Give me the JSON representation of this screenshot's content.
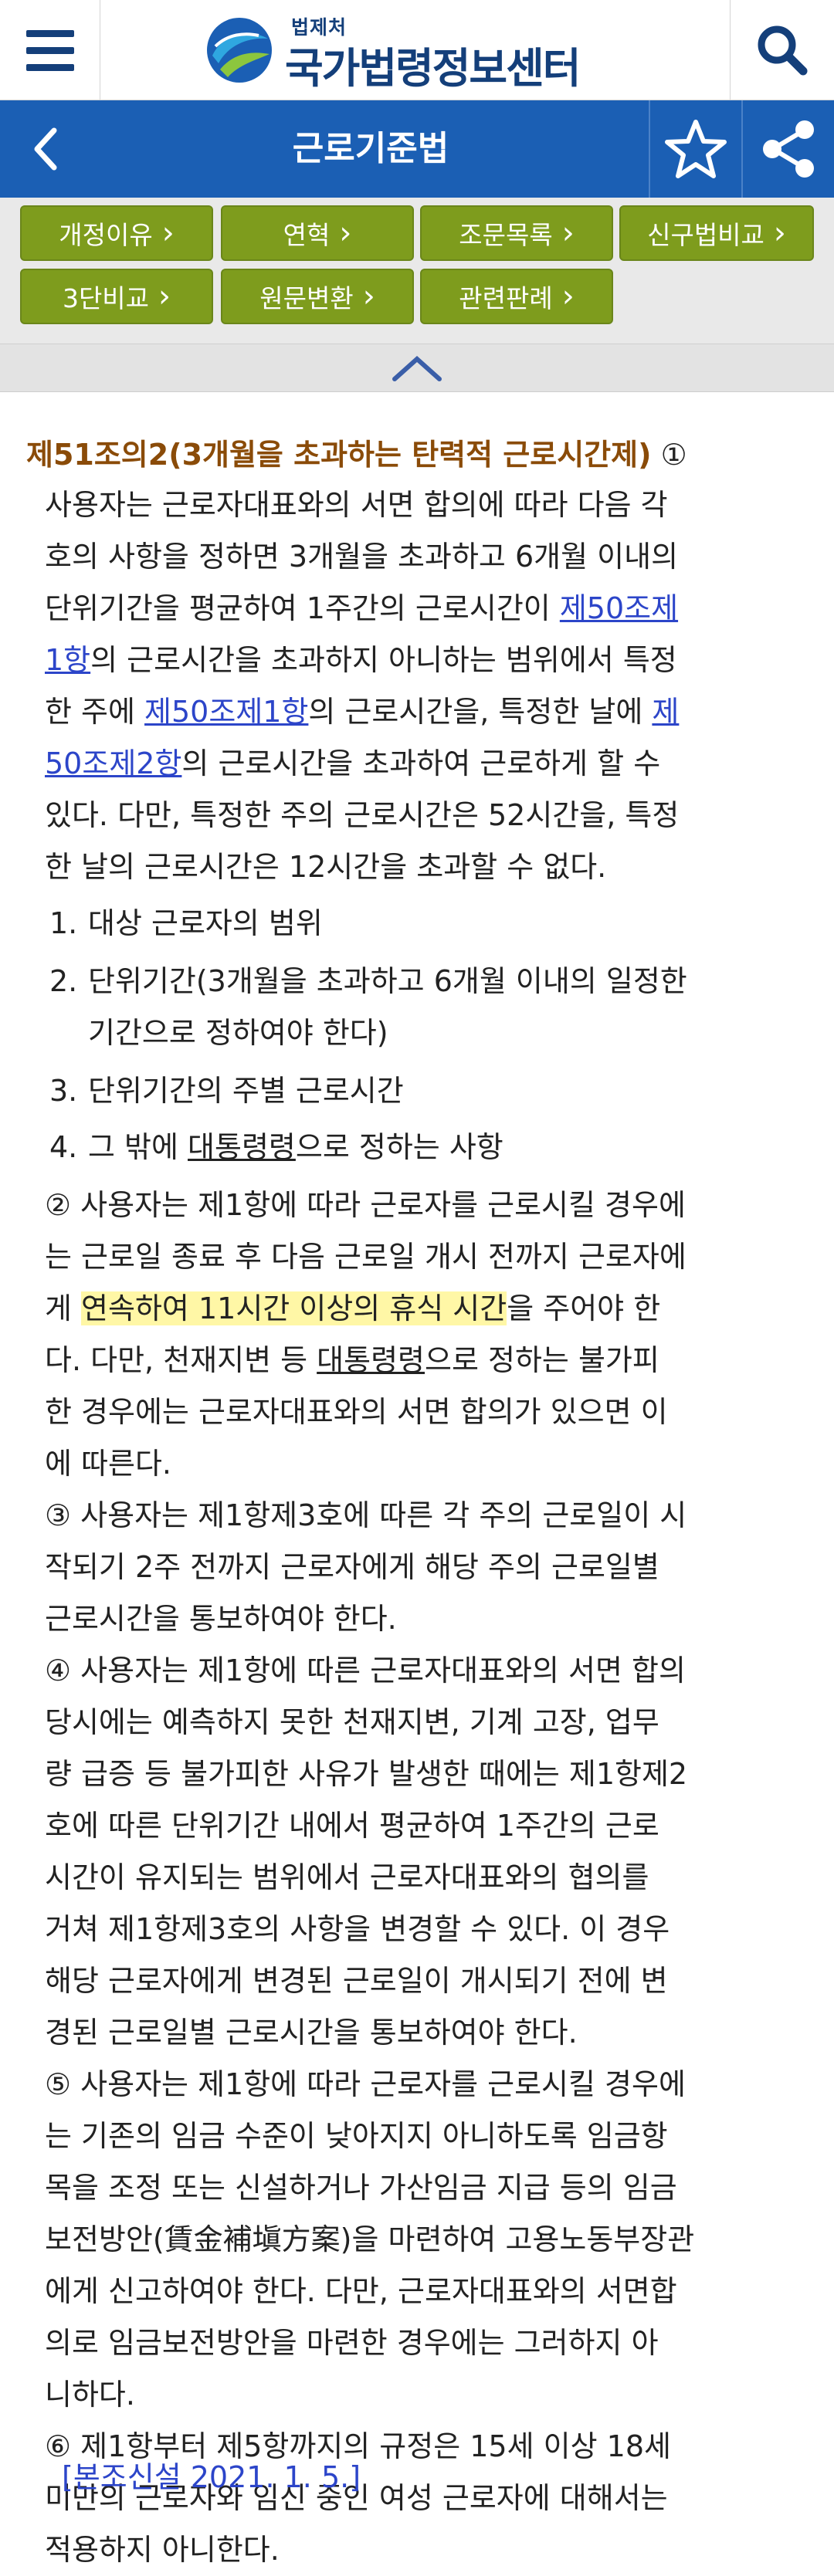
{
  "header": {
    "menu_icon": "hamburger-menu-icon",
    "logo_small": "법제처",
    "logo_big": "국가법령정보센터",
    "search_icon": "search-icon"
  },
  "titlebar": {
    "title": "근로기준법",
    "back_icon": "chevron-left-icon",
    "favorite_icon": "star-icon",
    "share_icon": "share-icon",
    "color": "#1b5fb4"
  },
  "buttons": [
    {
      "label": "개정이유"
    },
    {
      "label": "연혁"
    },
    {
      "label": "조문목록"
    },
    {
      "label": "신구법비교"
    },
    {
      "label": "3단비교"
    },
    {
      "label": "원문변환"
    },
    {
      "label": "관련판례"
    }
  ],
  "button_color": "#7e9c1d",
  "collapse_icon": "chevron-up-icon",
  "article": {
    "heading": "제51조의2(3개월을 초과하는 탄력적 근로시간제)",
    "circle1": "①",
    "p1": {
      "l1": "사용자는 근로자대표와의 서면 합의에 따라 다음 각",
      "l2": "호의 사항을 정하면 3개월을 초과하고 6개월 이내의",
      "l3a": "단위기간을 평균하여 1주간의 근로시간이 ",
      "l3_link": "제50조제",
      "l4_link": "1항",
      "l4b": "의 근로시간을 초과하지 아니하는 범위에서 특정",
      "l5a": "한 주에 ",
      "l5_link1": "제50조제1항",
      "l5b": "의 근로시간을, 특정한 날에 ",
      "l5_link2": "제",
      "l6_link": "50조제2항",
      "l6b": "의 근로시간을 초과하여 근로하게 할 수",
      "l7": "있다. 다만, 특정한 주의 근로시간은 52시간을, 특정",
      "l8": "한 날의 근로시간은 12시간을 초과할 수 없다."
    },
    "items": {
      "i1_num": "1.",
      "i1": "대상 근로자의 범위",
      "i2_num": "2.",
      "i2": "단위기간(3개월을 초과하고 6개월 이내의 일정한",
      "i2b": "기간으로 정하여야 한다)",
      "i3_num": "3.",
      "i3": "단위기간의 주별 근로시간",
      "i4_num": "4.",
      "i4a": "그 밖에 ",
      "i4_ul": "대통령령",
      "i4b": "으로 정하는 사항"
    },
    "p2": {
      "l1": "② 사용자는 제1항에 따라 근로자를 근로시킬 경우에",
      "l2": "는 근로일 종료 후 다음 근로일 개시 전까지 근로자에",
      "l3a": "게 ",
      "l3_hl": "연속하여 11시간 이상의 휴식 시간",
      "l3b": "을 주어야 한",
      "l4a": "다. 다만, 천재지변 등 ",
      "l4_ul": "대통령령",
      "l4b": "으로 정하는 불가피",
      "l5": "한 경우에는 근로자대표와의 서면 합의가 있으면 이",
      "l6": "에 따른다."
    },
    "p3": {
      "l1": "③ 사용자는 제1항제3호에 따른 각 주의 근로일이 시",
      "l2": "작되기 2주 전까지 근로자에게 해당 주의 근로일별",
      "l3": "근로시간을 통보하여야 한다."
    },
    "p4": {
      "l1": "④ 사용자는 제1항에 따른 근로자대표와의 서면 합의",
      "l2": "당시에는 예측하지 못한 천재지변, 기계 고장, 업무",
      "l3": "량 급증 등 불가피한 사유가 발생한 때에는 제1항제2",
      "l4": "호에 따른 단위기간 내에서 평균하여 1주간의 근로",
      "l5": "시간이 유지되는 범위에서 근로자대표와의 협의를",
      "l6": "거쳐 제1항제3호의 사항을 변경할 수 있다. 이 경우",
      "l7": "해당 근로자에게 변경된 근로일이 개시되기 전에 변",
      "l8": "경된 근로일별 근로시간을 통보하여야 한다."
    },
    "p5": {
      "l1": "⑤ 사용자는 제1항에 따라 근로자를 근로시킬 경우에",
      "l2": "는 기존의 임금 수준이 낮아지지 아니하도록 임금항",
      "l3": "목을 조정 또는 신설하거나 가산임금 지급 등의 임금",
      "l4": "보전방안(賃金補塡方案)을 마련하여 고용노동부장관",
      "l5": "에게 신고하여야 한다. 다만, 근로자대표와의 서면합",
      "l6": "의로 임금보전방안을 마련한 경우에는 그러하지 아",
      "l7": "니하다."
    },
    "p6": {
      "l1": "⑥ 제1항부터 제5항까지의 규정은 15세 이상 18세",
      "l2": "미만의 근로자와 임신 중인 여성 근로자에 대해서는",
      "l3": "적용하지 아니한다."
    },
    "note": "[본조신설 2021. 1. 5.]"
  }
}
